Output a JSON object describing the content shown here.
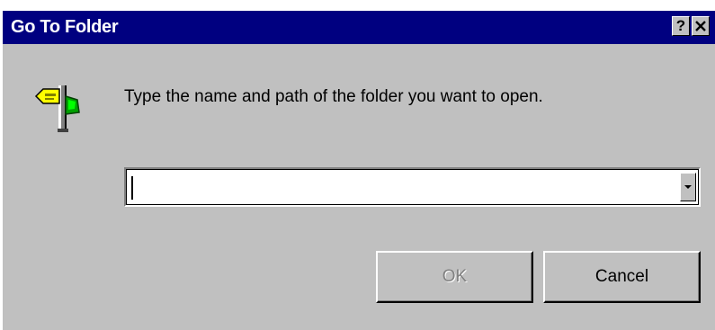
{
  "window": {
    "title": "Go To Folder",
    "help_label": "?",
    "close_label": "✕"
  },
  "dialog": {
    "icon": "signpost-folder-icon",
    "prompt": "Type the name and path of the folder you want to open.",
    "folder_input": {
      "value": "",
      "placeholder": ""
    }
  },
  "buttons": {
    "ok_label": "OK",
    "ok_enabled": false,
    "cancel_label": "Cancel"
  },
  "colors": {
    "titlebar": "#000080",
    "face": "#c0c0c0",
    "disabled_text": "#808080"
  }
}
